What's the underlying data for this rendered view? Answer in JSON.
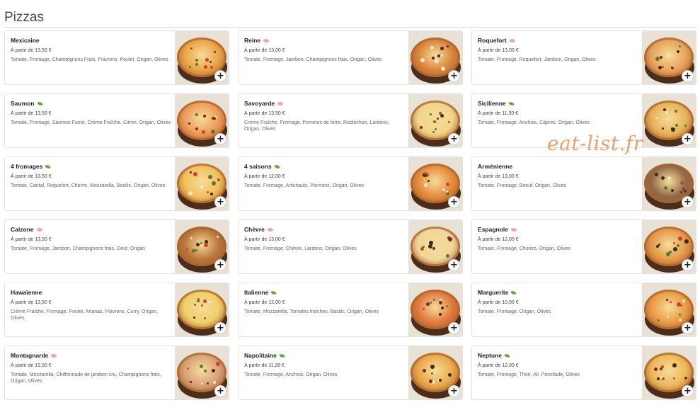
{
  "section": {
    "title": "Pizzas"
  },
  "watermark": "eat-list.fr",
  "add_label": "+",
  "colors": {
    "veg_tag": "#5cab3c",
    "meat_tag": "#f2a3b5",
    "watermark": "#f0a06a"
  },
  "pizzas": [
    {
      "name": "Mexicaine",
      "tag": "",
      "price": "À partir de 13,50 €",
      "desc": "Tomate, Fromage, Champignons Frais, Poivrons, Poulet, Origan, Olives",
      "tone": "#e9a347"
    },
    {
      "name": "Reine",
      "tag": "meat",
      "price": "À partir de 13,00 €",
      "desc": "Tomate, Fromage, Jambon, Champignons frais, Origan, Olives",
      "tone": "#d9833a"
    },
    {
      "name": "Roquefort",
      "tag": "meat",
      "price": "À partir de 13,00 €",
      "desc": "Tomate, Fromage, Roquefort, Jambon, Origan, Olives",
      "tone": "#e6a35c"
    },
    {
      "name": "Saumon",
      "tag": "leaf",
      "price": "À partir de 13,50 €",
      "desc": "Tomate, Fromage, Saumon Fumé, Crème Fraîche, Citron, Origan, Olives",
      "tone": "#ef9a5a"
    },
    {
      "name": "Savoyarde",
      "tag": "meat",
      "price": "À partir de 13,50 €",
      "desc": "Crème Fraîche, Fromage, Pommes de terre, Reblochon, Lardons, Origan, Olives",
      "tone": "#f0d58a"
    },
    {
      "name": "Sicilienne",
      "tag": "leaf",
      "price": "À partir de 11,50 €",
      "desc": "Tomate, Fromage, Anchois, Câpres, Origan, Olives",
      "tone": "#e7b35a"
    },
    {
      "name": "4 fromages",
      "tag": "leaf",
      "price": "À partir de 13,50 €",
      "desc": "Tomate, Cantal, Roquefort, Chèvre, Mozzarella, Basilic, Origan, Olives",
      "tone": "#f1c05c"
    },
    {
      "name": "4 saisons",
      "tag": "leaf",
      "price": "À partir de 12,00 €",
      "desc": "Tomate, Fromage, Artichauts, Poivrons, Origan, Olives",
      "tone": "#e58a3b"
    },
    {
      "name": "Arménienne",
      "tag": "",
      "price": "À partir de 13,00 €",
      "desc": "Tomate, Fromage, Boeuf, Origan, Olives",
      "tone": "#8f6a4a"
    },
    {
      "name": "Calzone",
      "tag": "meat",
      "price": "À partir de 13,50 €",
      "desc": "Tomate, Fromage, Jambon, Champignons frais, Oeuf, Origan",
      "tone": "#b8743a"
    },
    {
      "name": "Chèvre",
      "tag": "meat",
      "price": "À partir de 13,00 €",
      "desc": "Tomate, Fromage, Chèvre, Lardons, Origan, Olives",
      "tone": "#efd79a"
    },
    {
      "name": "Espagnole",
      "tag": "meat",
      "price": "À partir de 12,00 €",
      "desc": "Tomate, Fromage, Chorizo, Origan, Olives",
      "tone": "#e39a48"
    },
    {
      "name": "Hawaïenne",
      "tag": "",
      "price": "À partir de 13,50 €",
      "desc": "Crème Fraîche, Fromage, Poulet, Ananas, Poivrons, Curry, Origan, Olives",
      "tone": "#efcf6a"
    },
    {
      "name": "Italienne",
      "tag": "leaf",
      "price": "À partir de 12,00 €",
      "desc": "Tomate, Mozzarella, Tomates fraîches, Basilic, Origan, Olives",
      "tone": "#e0783e"
    },
    {
      "name": "Marguerite",
      "tag": "leaf",
      "price": "À partir de 10,90 €",
      "desc": "Tomate, Fromage, Origan, Olives",
      "tone": "#eb9a45"
    },
    {
      "name": "Montagnarde",
      "tag": "meat",
      "price": "À partir de 13,50 €",
      "desc": "Tomate, Mozzarella, Chiffonnade de jambon cru, Champignons frais, Origan, Olives",
      "tone": "#d8a07a"
    },
    {
      "name": "Napolitaine",
      "tag": "leaf",
      "price": "À partir de 11,20 €",
      "desc": "Tomate, Fromage, Anchois, Origan, Olives",
      "tone": "#eaa84c"
    },
    {
      "name": "Neptune",
      "tag": "leaf",
      "price": "À partir de 12,00 €",
      "desc": "Tomate, Fromage, Thon, Ail, Persillade, Olives",
      "tone": "#ecb85a"
    }
  ]
}
